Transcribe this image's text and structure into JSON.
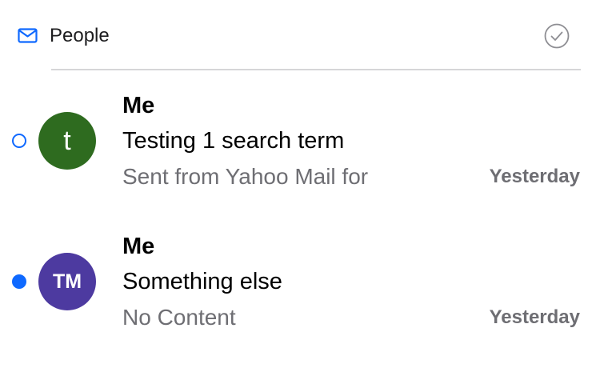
{
  "header": {
    "title": "People",
    "icon": "mail-icon",
    "select_icon": "checkmark-circle-icon"
  },
  "colors": {
    "accent": "#0f69ff",
    "secondary_text": "#6e6e73",
    "divider": "#d6d6d8"
  },
  "messages": [
    {
      "avatar_initials": "t",
      "avatar_color": "#2e6b1f",
      "sender": "Me",
      "subject": "Testing 1 search term",
      "snippet": "Sent from Yahoo Mail for",
      "date": "Yesterday",
      "unread": false
    },
    {
      "avatar_initials": "TM",
      "avatar_color": "#4d3aa0",
      "sender": "Me",
      "subject": "Something else",
      "snippet": "No Content",
      "date": "Yesterday",
      "unread": true
    }
  ]
}
